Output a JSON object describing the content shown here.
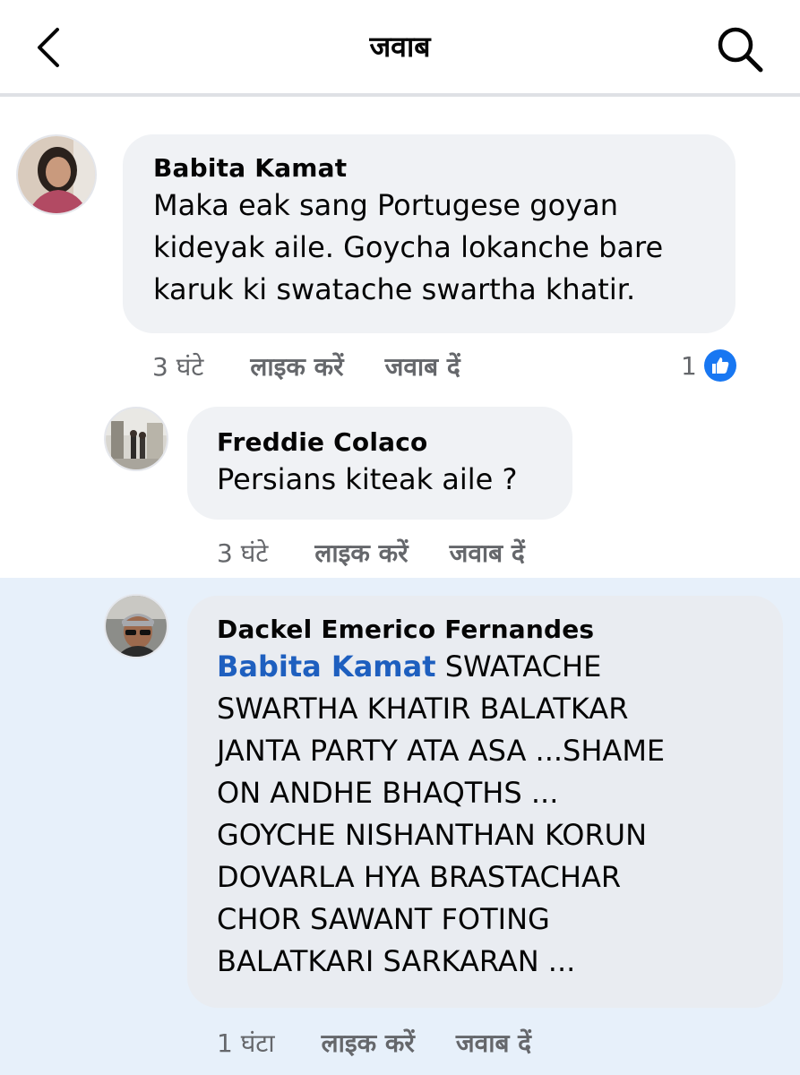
{
  "header": {
    "title": "जवाब",
    "back_icon": "chevron-left-icon",
    "search_icon": "search-icon"
  },
  "comments": [
    {
      "author": "Babita Kamat",
      "text": "Maka eak sang Portugese goyan\nkideyak aile. Goycha lokanche bare\nkaruk ki swatache swartha khatir.",
      "time": "3 घंटे",
      "like_label": "लाइक करें",
      "reply_label": "जवाब दें",
      "reaction_count": "1"
    },
    {
      "author": "Freddie Colaco",
      "text": "Persians kiteak aile ?",
      "time": "3 घंटे",
      "like_label": "लाइक करें",
      "reply_label": "जवाब दें"
    },
    {
      "author": "Dackel Emerico Fernandes",
      "mention": "Babita Kamat",
      "text": " SWATACHE\nSWARTHA KHATIR BALATKAR\nJANTA PARTY ATA ASA ...SHAME\nON ANDHE BHAQTHS ...\nGOYCHE NISHANTHAN  KORUN\nDOVARLA HYA BRASTACHAR\nCHOR SAWANT FOTING\nBALATKARI SARKARAN ...",
      "time": "1 घंटा",
      "like_label": "लाइक करें",
      "reply_label": "जवाब दें"
    }
  ],
  "colors": {
    "link_blue": "#1e5fbf",
    "like_blue": "#1877f2",
    "highlight": "#e7f0fa",
    "bubble": "#f0f2f5"
  }
}
